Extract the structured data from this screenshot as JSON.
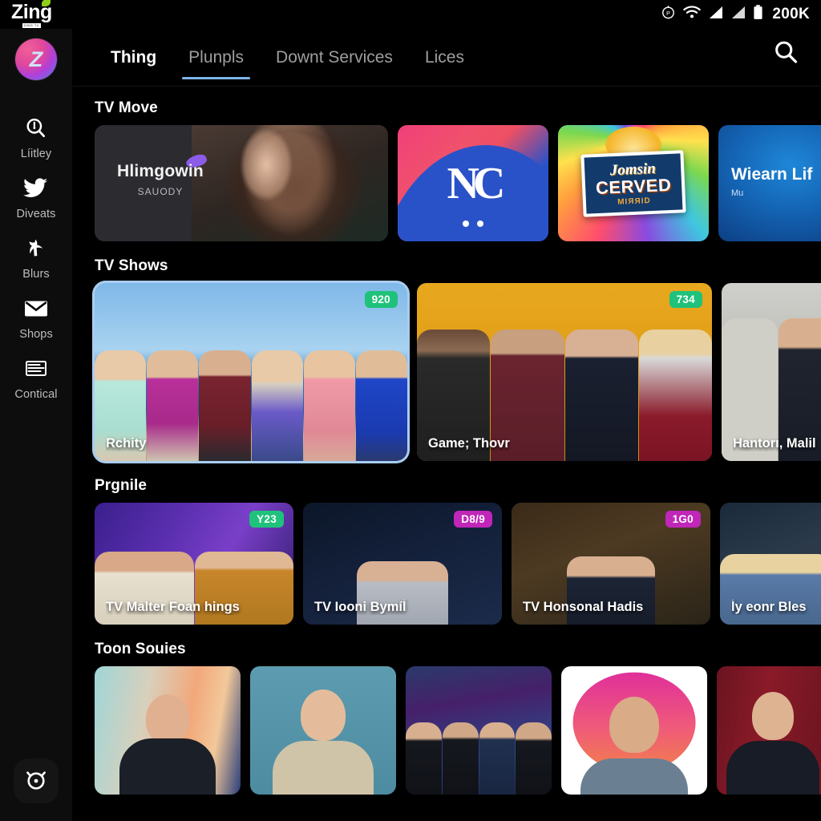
{
  "statusbar": {
    "brand": "Zing",
    "brand_sub": "ZING TV",
    "battery_label": "200K",
    "icons": [
      "compass-icon",
      "wifi-icon",
      "signal-icon",
      "signal-alt-icon",
      "battery-icon"
    ]
  },
  "sidebar": {
    "avatar_letter": "Z",
    "items": [
      {
        "label": "Líitley",
        "icon": "search-circle-icon"
      },
      {
        "label": "Diveats",
        "icon": "bird-icon"
      },
      {
        "label": "Blurs",
        "icon": "person-walk-icon"
      },
      {
        "label": "Shops",
        "icon": "envelope-icon"
      },
      {
        "label": "Contical",
        "icon": "list-lines-icon"
      }
    ],
    "fab_icon": "alarm-target-icon"
  },
  "topbar": {
    "tabs": [
      {
        "label": "Thing",
        "active": true,
        "underlined": false
      },
      {
        "label": "Plunpls",
        "active": false,
        "underlined": true
      },
      {
        "label": "Downt Services",
        "active": false,
        "underlined": false
      },
      {
        "label": "Lices",
        "active": false,
        "underlined": false
      }
    ],
    "search_icon": "search-icon"
  },
  "sections": [
    {
      "title": "TV Move",
      "cards": [
        {
          "title": "Hlimgowin",
          "subtitle": "SAUODY"
        },
        {
          "title": "NC"
        },
        {
          "title": "Jomsin",
          "title2": "CERVED",
          "title3": "MIЯЯID"
        },
        {
          "title": "Wiearn Lif",
          "subtitle": "Mu"
        }
      ]
    },
    {
      "title": "TV Shows",
      "cards": [
        {
          "title": "Rchity",
          "badge": "920",
          "badge_color": "green",
          "focused": true
        },
        {
          "title": "Game; Thovr",
          "badge": "734",
          "badge_color": "green"
        },
        {
          "title": "Hantorı, Malil"
        }
      ]
    },
    {
      "title": "Prgnile",
      "cards": [
        {
          "title": "TV Malter Foan hings",
          "badge": "Y23",
          "badge_color": "green"
        },
        {
          "title": "TV Iooni Bymíĺ",
          "badge": "D8/9",
          "badge_color": "magenta"
        },
        {
          "title": "TV Honsonal Hadis",
          "badge": "1G0",
          "badge_color": "magenta"
        },
        {
          "title": "ĺy eonr Bles"
        }
      ]
    },
    {
      "title": "Toon Souies",
      "cards": [
        {
          "title": ""
        },
        {
          "title": ""
        },
        {
          "title": ""
        },
        {
          "title": ""
        },
        {
          "title": ""
        }
      ]
    }
  ],
  "colors": {
    "background": "#000000",
    "sidebar": "#0d0d0d",
    "accent_underline": "#7fb4ea",
    "focus_border": "#a9cdf0",
    "badge_green": "#1fc27a",
    "badge_magenta": "#c026b8",
    "text_primary": "#ffffff",
    "text_muted": "#9e9e9e",
    "brand_leaf": "#8ed11a"
  }
}
